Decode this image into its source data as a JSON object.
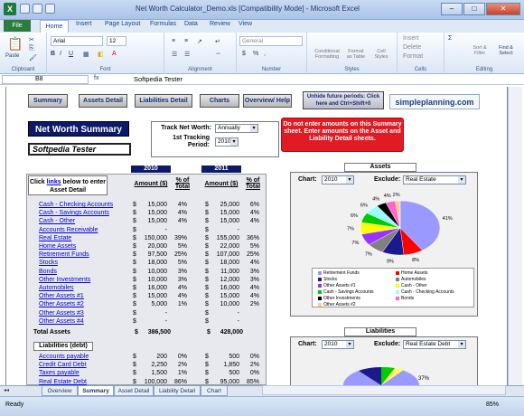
{
  "window": {
    "title": "Net Worth Calculator_Demo.xls  [Compatibility Mode] - Microsoft Excel",
    "app_icon": "excel-icon"
  },
  "ribbon_tabs": [
    "File",
    "Home",
    "Insert",
    "Page Layout",
    "Formulas",
    "Data",
    "Review",
    "View"
  ],
  "ribbon": {
    "clipboard": {
      "paste": "Paste",
      "label": "Clipboard"
    },
    "font": {
      "name": "Arial",
      "size": "12",
      "label": "Font"
    },
    "alignment": {
      "label": "Alignment"
    },
    "number": {
      "format": "General",
      "label": "Number"
    },
    "styles": {
      "conditional": "Conditional Formatting",
      "format_table": "Format as Table",
      "cell_styles": "Cell Styles",
      "label": "Styles"
    },
    "cells": {
      "insert": "Insert",
      "delete": "Delete",
      "format": "Format",
      "label": "Cells"
    },
    "editing": {
      "sort": "Sort & Filter",
      "find": "Find & Select",
      "label": "Editing"
    }
  },
  "formula_bar": {
    "name_box": "B8",
    "fx": "fx",
    "value": "Softpedia Tester"
  },
  "nav_buttons": [
    "Summary",
    "Assets Detail",
    "Liabilities Detail",
    "Charts",
    "Overview/ Help"
  ],
  "unhide": "Unhide future periods: Click here and Ctrl+Shift+0",
  "brand": "simpleplanning.com",
  "summary_title": "Net Worth Summary",
  "name_field": "Softpedia Tester",
  "track": {
    "label1": "Track Net Worth:",
    "value1": "Annually",
    "label2": "1st Tracking Period:",
    "value2": "2010"
  },
  "warning": "Do not enter amounts on this Summary sheet.  Enter amounts on the Asset  and Liability Detail sheets.",
  "years": [
    "2010",
    "2011"
  ],
  "click_note": {
    "pre": "Click ",
    "link": "links",
    "post": " below to enter Asset  Detail"
  },
  "col_headers": {
    "amount": "Amount ($)",
    "pct": "% of Total"
  },
  "assets": [
    {
      "name": "Cash - Checking Accounts",
      "a1": "15,000",
      "p1": "4%",
      "a2": "25,000",
      "p2": "6%"
    },
    {
      "name": "Cash - Savings Accounts",
      "a1": "15,000",
      "p1": "4%",
      "a2": "15,000",
      "p2": "4%"
    },
    {
      "name": "Cash - Other",
      "a1": "15,000",
      "p1": "4%",
      "a2": "15,000",
      "p2": "4%"
    },
    {
      "name": "Accounts Receivable",
      "a1": "-",
      "p1": "",
      "a2": "-",
      "p2": ""
    },
    {
      "name": "Real Estate",
      "a1": "150,000",
      "p1": "39%",
      "a2": "155,000",
      "p2": "36%"
    },
    {
      "name": "Home Assets",
      "a1": "20,000",
      "p1": "5%",
      "a2": "22,000",
      "p2": "5%"
    },
    {
      "name": "Retirement Funds",
      "a1": "97,500",
      "p1": "25%",
      "a2": "107,000",
      "p2": "25%"
    },
    {
      "name": "Stocks",
      "a1": "18,000",
      "p1": "5%",
      "a2": "18,000",
      "p2": "4%"
    },
    {
      "name": "Bonds",
      "a1": "10,000",
      "p1": "3%",
      "a2": "11,000",
      "p2": "3%"
    },
    {
      "name": "Other Investments",
      "a1": "10,000",
      "p1": "3%",
      "a2": "12,000",
      "p2": "3%"
    },
    {
      "name": "Automobiles",
      "a1": "16,000",
      "p1": "4%",
      "a2": "16,000",
      "p2": "4%"
    },
    {
      "name": "Other Assets #1",
      "a1": "15,000",
      "p1": "4%",
      "a2": "15,000",
      "p2": "4%"
    },
    {
      "name": "Other Assets #2",
      "a1": "5,000",
      "p1": "1%",
      "a2": "10,000",
      "p2": "2%"
    },
    {
      "name": "Other Assets #3",
      "a1": "-",
      "p1": "",
      "a2": "-",
      "p2": ""
    },
    {
      "name": "Other Assets #4",
      "a1": "-",
      "p1": "",
      "a2": "-",
      "p2": ""
    }
  ],
  "total_assets": {
    "label": "Total Assets",
    "a1": "386,500",
    "a2": "428,000"
  },
  "liab_title": "Liabilities (debt)",
  "liabilities": [
    {
      "name": "Accounts payable",
      "a1": "200",
      "p1": "0%",
      "a2": "500",
      "p2": "0%"
    },
    {
      "name": "Credit Card Debt",
      "a1": "2,250",
      "p1": "2%",
      "a2": "1,850",
      "p2": "2%"
    },
    {
      "name": "Taxes payable",
      "a1": "1,500",
      "p1": "1%",
      "a2": "500",
      "p2": "0%"
    },
    {
      "name": "Real Estate Debt",
      "a1": "100,000",
      "p1": "86%",
      "a2": "95,000",
      "p2": "85%"
    }
  ],
  "currency": "$",
  "assets_chart": {
    "title": "Assets",
    "chart_label": "Chart:",
    "chart_value": "2010",
    "exclude_label": "Exclude:",
    "exclude_value": "Real Estate"
  },
  "liab_chart": {
    "title": "Liabilities",
    "chart_label": "Chart:",
    "chart_value": "2010",
    "exclude_label": "Exclude:",
    "exclude_value": "Real Estate Debt",
    "pct": "37%"
  },
  "chart_data": [
    {
      "type": "pie",
      "title": "Assets",
      "slices": [
        {
          "label": "Retirement Funds",
          "value": 41,
          "color": "#9999ff"
        },
        {
          "label": "Home Assets",
          "value": 8,
          "color": "#ff0000"
        },
        {
          "label": "Stocks",
          "value": 9,
          "color": "#1a1a8c"
        },
        {
          "label": "Automobiles",
          "value": 7,
          "color": "#808080"
        },
        {
          "label": "Other Assets #1",
          "value": 7,
          "color": "#9933ff"
        },
        {
          "label": "Cash - Other",
          "value": 7,
          "color": "#ffff00"
        },
        {
          "label": "Cash - Savings Accounts",
          "value": 6,
          "color": "#00cc00"
        },
        {
          "label": "Cash - Checking Accounts",
          "value": 6,
          "color": "#99ffff"
        },
        {
          "label": "Other Investments",
          "value": 4,
          "color": "#000000"
        },
        {
          "label": "Bonds",
          "value": 4,
          "color": "#ff66cc"
        },
        {
          "label": "Other Assets #2",
          "value": 2,
          "color": "#ffcc99"
        }
      ],
      "labels_shown": [
        "41%",
        "8%",
        "9%",
        "7%",
        "7%",
        "7%",
        "6%",
        "6%",
        "4%",
        "4%",
        "2%"
      ]
    }
  ],
  "legend_items": [
    "Retirement Funds",
    "Home Assets",
    "Stocks",
    "Automobiles",
    "Other Assets #1",
    "Cash - Other",
    "Cash - Savings Accounts",
    "Cash - Checking Accounts",
    "Other Investments",
    "Bonds",
    "Other Assets #2"
  ],
  "sheet_tabs": [
    "Overview",
    "Summary",
    "Asset Detail",
    "Liability Detail",
    "Chart"
  ],
  "status": {
    "ready": "Ready",
    "zoom": "85%"
  }
}
